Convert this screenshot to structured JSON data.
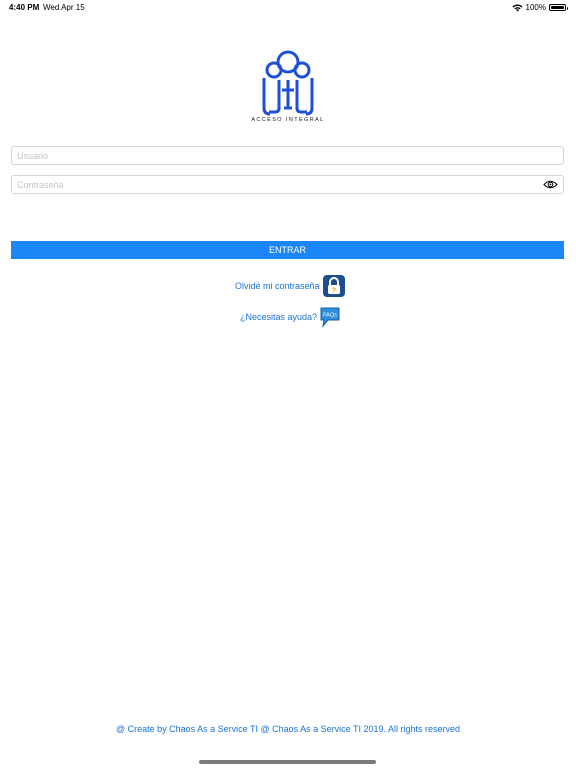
{
  "status_bar": {
    "time": "4:40 PM",
    "date": "Wed Apr 15",
    "battery": "100%"
  },
  "logo": {
    "caption": "ACCESO INTEGRAL"
  },
  "form": {
    "username_placeholder": "Usuario",
    "password_placeholder": "Contraseña",
    "submit_label": "ENTRAR"
  },
  "links": {
    "forgot_password": "Olvidé mi contraseña",
    "need_help": "¿Necesitas ayuda?",
    "faq_badge": "FAQs"
  },
  "footer": {
    "text": "@ Create by Chaos As a Service TI @ Chaos As a Service TI 2019. All rights reserved"
  },
  "colors": {
    "accent": "#1a86f7",
    "link": "#1a73d6",
    "logo_blue": "#1f4fd6"
  }
}
